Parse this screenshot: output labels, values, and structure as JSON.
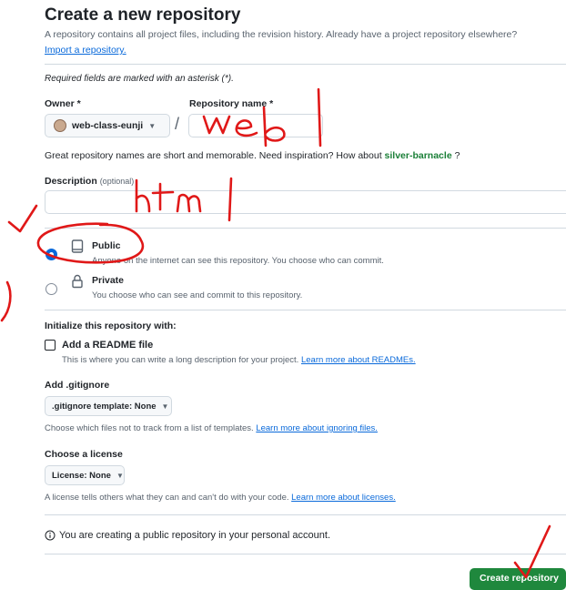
{
  "header": {
    "title": "Create a new repository",
    "subtitle": "A repository contains all project files, including the revision history. Already have a project repository elsewhere?",
    "import_link": "Import a repository."
  },
  "required_note": "Required fields are marked with an asterisk (*).",
  "owner": {
    "label": "Owner *",
    "value": "web-class-eunji"
  },
  "slash": "/",
  "repo_name": {
    "label": "Repository name *",
    "value": ""
  },
  "name_hint": {
    "prefix": "Great repository names are short and memorable. Need inspiration? How about",
    "suggestion": "silver-barnacle",
    "suffix": "?"
  },
  "description": {
    "label": "Description",
    "optional": "(optional)",
    "value": ""
  },
  "visibility": {
    "selected": "public",
    "options": [
      {
        "title": "Public",
        "desc": "Anyone on the internet can see this repository. You choose who can commit."
      },
      {
        "title": "Private",
        "desc": "You choose who can see and commit to this repository."
      }
    ]
  },
  "initialize": {
    "heading": "Initialize this repository with:",
    "readme_label": "Add a README file",
    "readme_checked": false,
    "readme_desc": "This is where you can write a long description for your project.",
    "readme_link": "Learn more about READMEs."
  },
  "gitignore": {
    "label": "Add .gitignore",
    "button": ".gitignore template: None",
    "desc": "Choose which files not to track from a list of templates.",
    "link": "Learn more about ignoring files."
  },
  "license": {
    "label": "Choose a license",
    "button": "License: None",
    "desc": "A license tells others what they can and can't do with your code.",
    "link": "Learn more about licenses."
  },
  "notice": "You are creating a public repository in your personal account.",
  "create_button": "Create repository",
  "colors": {
    "accent": "#0969da",
    "primary_button": "#1f883d",
    "suggestion": "#1a7f37",
    "annotation_ink": "#e01818"
  }
}
